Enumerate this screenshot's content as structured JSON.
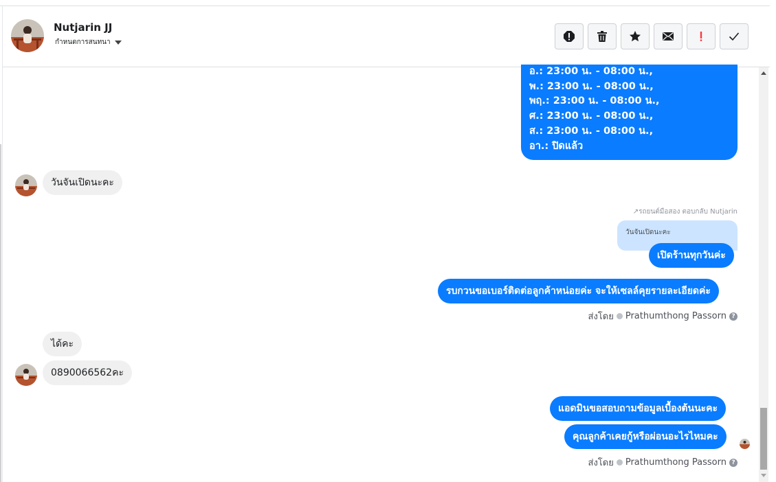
{
  "header": {
    "contact_name": "Nutjarin JJ",
    "settings_label": "กำหนดการสนทนา",
    "actions": [
      "report-icon",
      "trash-icon",
      "star-icon",
      "mail-icon",
      "exclamation-icon",
      "check-icon"
    ]
  },
  "colors": {
    "outgoing": "#0a7cff",
    "incoming": "#f0f0f0",
    "quote": "#cce4ff",
    "exclamation": "#fa383e"
  },
  "messages": {
    "hours_lines": [
      "อ.: 23:00 น. - 08:00 น.,",
      "พ.: 23:00 น. - 08:00 น.,",
      "พฤ.: 23:00 น. - 08:00 น.,",
      "ศ.: 23:00 น. - 08:00 น.,",
      "ส.: 23:00 น. - 08:00 น.,",
      "อา.: ปิดแล้ว"
    ],
    "in_1": "วันจันเปิดนะคะ",
    "reply_meta": "รถยนต์มือสอง ตอบกลับ Nutjarin",
    "quoted_text": "วันจันเปิดนะคะ",
    "out_1": "เปิดร้านทุกวันค่ะ",
    "out_2": "รบกวนขอเบอร์ติดต่อลูกค้าหน่อยค่ะ จะให้เซลล์คุยรายละเอียดค่ะ",
    "sent_by_1_prefix": "ส่งโดย",
    "sent_by_1_agent": "Prathumthong Passorn",
    "in_2": "ได้คะ",
    "in_3": "0890066562คะ",
    "out_3": "แอดมินขอสอบถามข้อมูลเบื้องต้นนะคะ",
    "out_4": "คุณลูกค้าเคยกู้หรือผ่อนอะไรไหมคะ",
    "sent_by_2_prefix": "ส่งโดย",
    "sent_by_2_agent": "Prathumthong Passorn"
  }
}
